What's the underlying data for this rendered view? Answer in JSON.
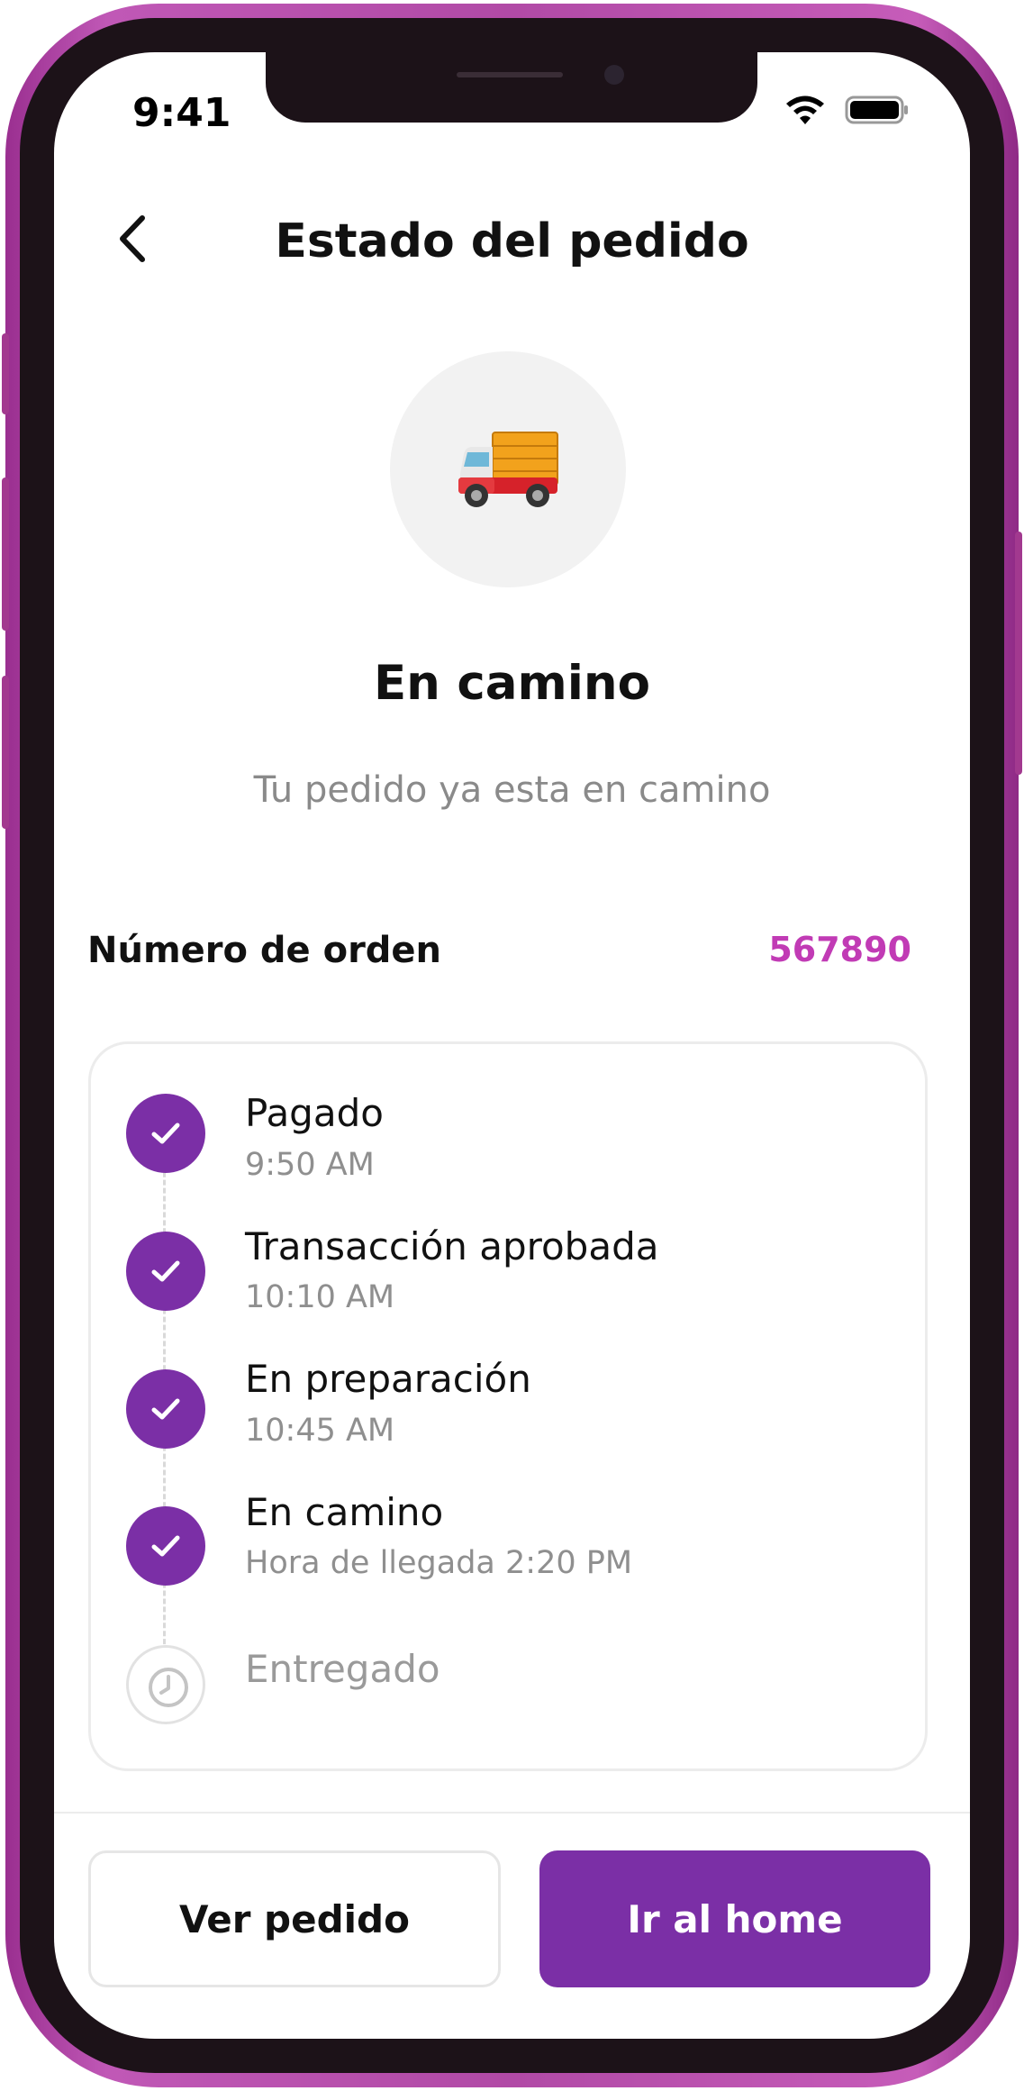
{
  "status_bar": {
    "time": "9:41"
  },
  "header": {
    "title": "Estado del pedido"
  },
  "hero": {
    "icon": "delivery-truck-icon",
    "title": "En camino",
    "subtitle": "Tu pedido ya esta en camino"
  },
  "order": {
    "label": "Número de orden",
    "number": "567890"
  },
  "timeline": [
    {
      "title": "Pagado",
      "time": "9:50 AM",
      "state": "done"
    },
    {
      "title": "Transacción aprobada",
      "time": "10:10 AM",
      "state": "done"
    },
    {
      "title": "En preparación",
      "time": "10:45 AM",
      "state": "done"
    },
    {
      "title": "En camino",
      "time": "Hora de llegada 2:20 PM",
      "state": "done"
    },
    {
      "title": "Entregado",
      "state": "pending"
    }
  ],
  "actions": {
    "view_order": "Ver pedido",
    "go_home": "Ir al home"
  },
  "colors": {
    "primary": "#7b2fa6",
    "accent": "#c13bb5",
    "frame": "#b14aa6"
  }
}
